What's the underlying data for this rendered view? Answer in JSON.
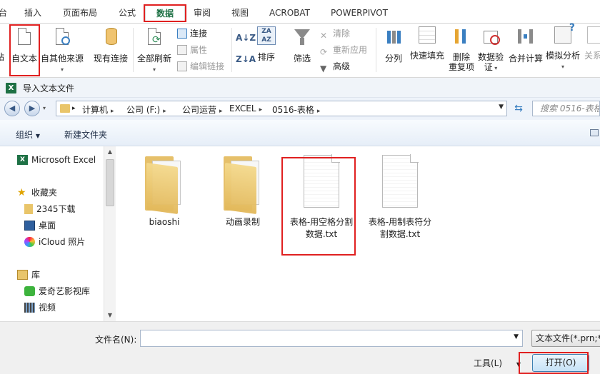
{
  "ribbon_tabs": [
    "台",
    "插入",
    "页面布局",
    "公式",
    "数据",
    "审阅",
    "视图",
    "ACROBAT",
    "POWERPIVOT"
  ],
  "active_tab": "数据",
  "ribbon": {
    "partial_left": "站",
    "from_text": "自文本",
    "from_other_l1": "自其他来源",
    "existing_conn": "现有连接",
    "refresh_all": "全部刷新",
    "connections": "连接",
    "properties": "属性",
    "edit_links": "编辑链接",
    "sort": "排序",
    "filter": "筛选",
    "clear": "清除",
    "reapply": "重新应用",
    "advanced": "高级",
    "split": "分列",
    "flash_fill": "快速填充",
    "remove_dup_l1": "删除",
    "remove_dup_l2": "重复项",
    "validation_l1": "数据验",
    "validation_l2": "证",
    "consolidate": "合并计算",
    "what_if": "模拟分析",
    "relationships": "关系"
  },
  "dialog": {
    "title": "导入文本文件",
    "breadcrumbs": [
      "计算机",
      "公司 (F:)",
      "公司运营",
      "EXCEL",
      "0516-表格"
    ],
    "search_placeholder": "搜索 0516-表格",
    "organize": "组织",
    "new_folder": "新建文件夹",
    "nav": {
      "excel": "Microsoft Excel",
      "favorites": "收藏夹",
      "downloads": "2345下载",
      "desktop": "桌面",
      "icloud": "iCloud 照片",
      "libraries": "库",
      "iqiyi": "爱奇艺影视库",
      "videos": "视频"
    },
    "files": [
      {
        "name": "biaoshi",
        "type": "folder"
      },
      {
        "name": "动画录制",
        "type": "folder"
      },
      {
        "name_l1": "表格-用空格分割",
        "name_l2": "数据.txt",
        "type": "txt"
      },
      {
        "name_l1": "表格-用制表符分",
        "name_l2": "割数据.txt",
        "type": "txt"
      }
    ],
    "filename_label": "文件名(N):",
    "filename_value": "",
    "filetype": "文本文件(*.prn;*.txt;*.csv)",
    "tools": "工具(L)",
    "open": "打开(O)"
  },
  "colors": {
    "excel_green": "#1e7145",
    "highlight_red": "#e02020"
  }
}
